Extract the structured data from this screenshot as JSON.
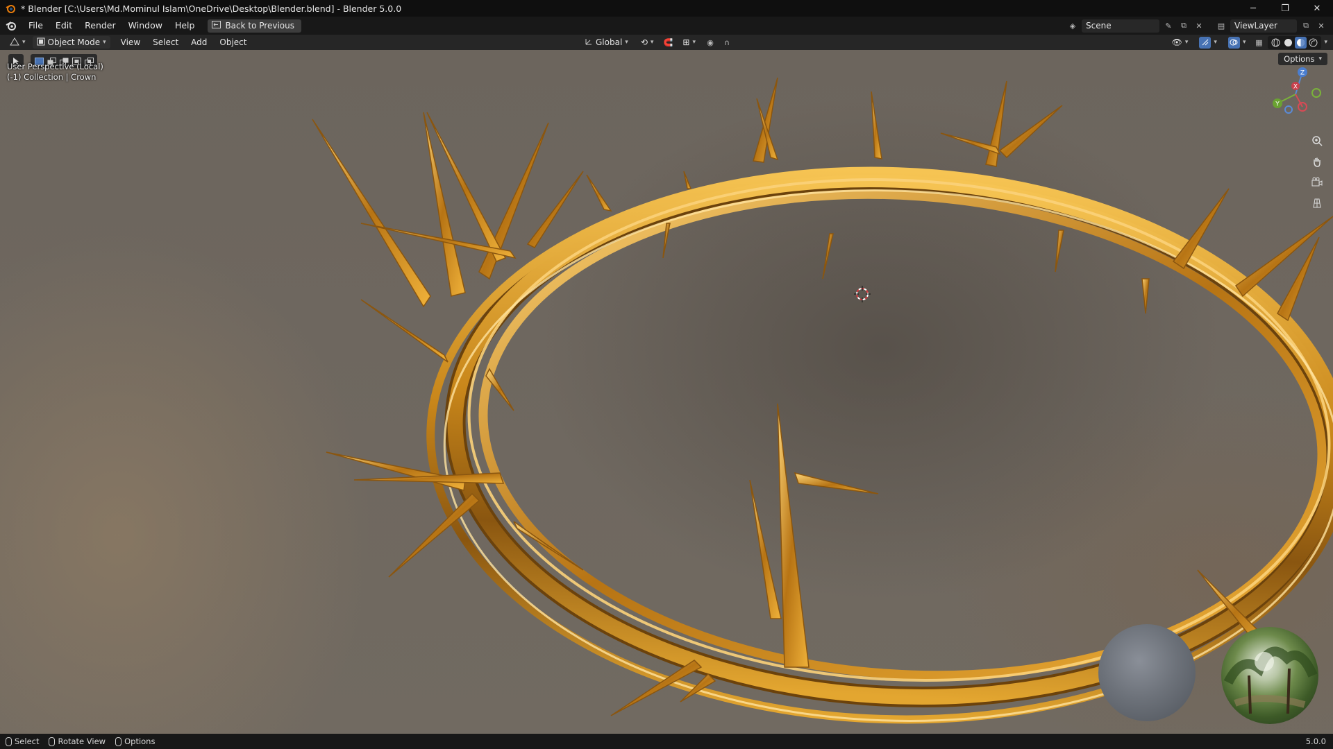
{
  "window": {
    "title": "* Blender [C:\\Users\\Md.Mominul Islam\\OneDrive\\Desktop\\Blender.blend] - Blender 5.0.0",
    "controls": [
      "minimize",
      "maximize",
      "close"
    ]
  },
  "menubar": {
    "items": [
      "File",
      "Edit",
      "Render",
      "Window",
      "Help"
    ],
    "back_button": "Back to Previous",
    "scene": "Scene",
    "view_layer": "ViewLayer"
  },
  "viewport_header": {
    "mode": "Object Mode",
    "menus": [
      "View",
      "Select",
      "Add",
      "Object"
    ],
    "orientation": "Global",
    "shading_active": "material-preview"
  },
  "viewport": {
    "perspective_label": "User Perspective (Local)",
    "collection_label": "(-1) Collection | Crown",
    "options_label": "Options",
    "gizmo_axes": [
      "X",
      "Y",
      "Z"
    ],
    "object_color": "#d9a12a",
    "accent_color": "#4772b3"
  },
  "statusbar": {
    "items": [
      "Select",
      "Rotate View",
      "Options"
    ],
    "version": "5.0.0"
  }
}
